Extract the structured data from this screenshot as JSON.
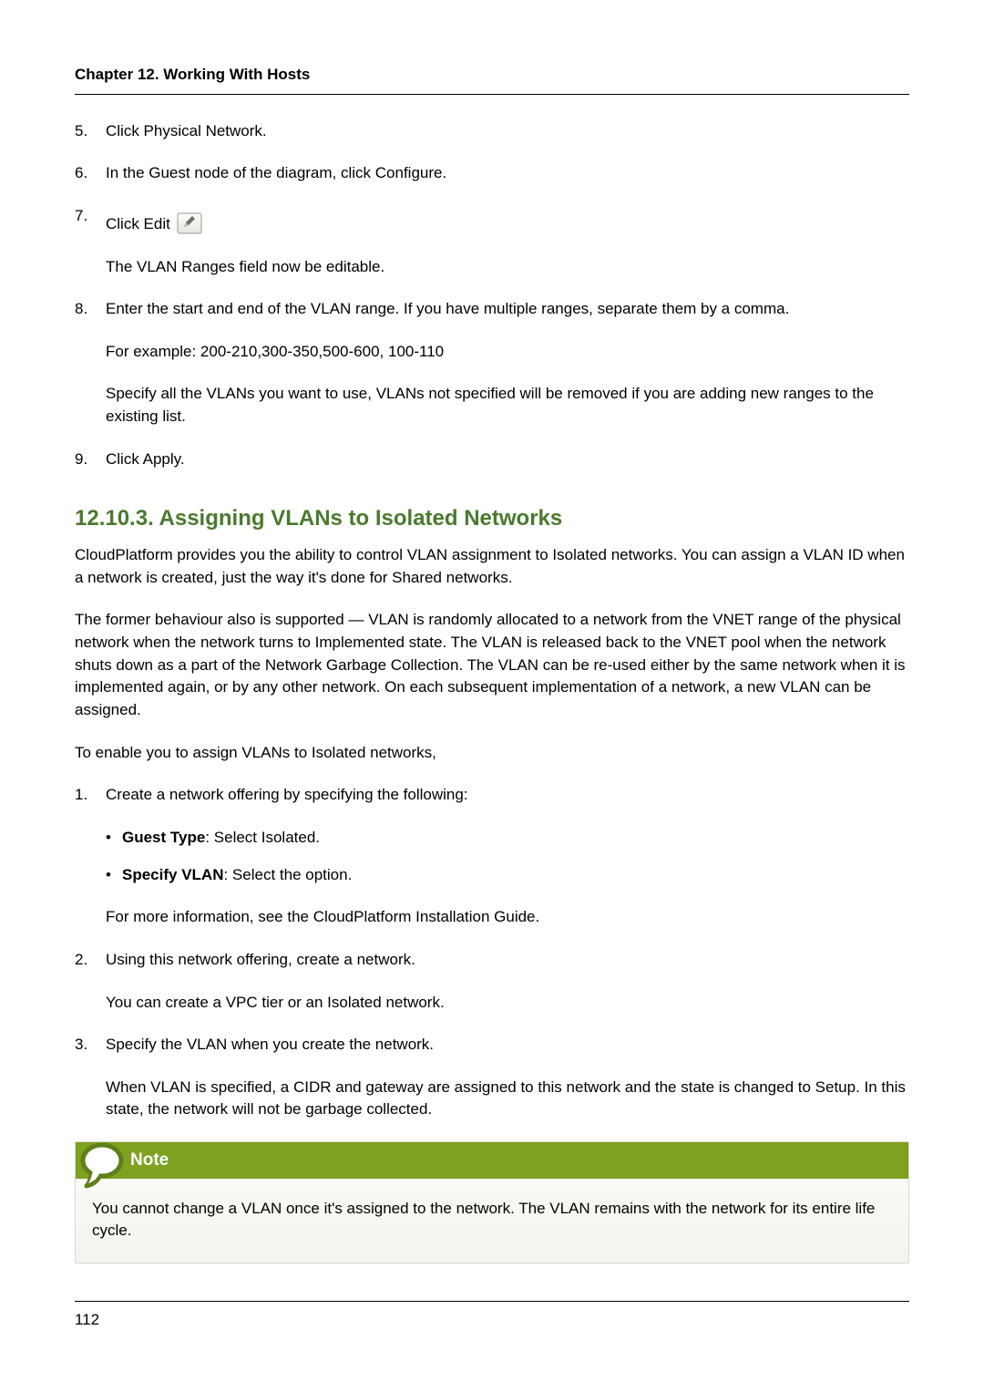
{
  "running_head": "Chapter 12. Working With Hosts",
  "steps_a": {
    "5": {
      "num": "5.",
      "p1": "Click Physical Network."
    },
    "6": {
      "num": "6.",
      "p1": "In the Guest node of the diagram, click Configure."
    },
    "7": {
      "num": "7.",
      "p1_prefix": "Click Edit ",
      "p2": "The VLAN Ranges field now be editable."
    },
    "8": {
      "num": "8.",
      "p1": "Enter the start and end of the VLAN range. If you have multiple ranges, separate them by a comma.",
      "p2": "For example: 200-210,300-350,500-600, 100-110",
      "p3": "Specify all the VLANs you want to use, VLANs not specified will be removed if you are adding new ranges to the existing list."
    },
    "9": {
      "num": "9.",
      "p1": "Click Apply."
    }
  },
  "section": {
    "heading": "12.10.3. Assigning VLANs to Isolated Networks",
    "p1": "CloudPlatform provides you the ability to control VLAN assignment to Isolated networks. You can assign a VLAN ID when a network is created, just the way it's done for Shared networks.",
    "p2": "The former behaviour also is supported — VLAN is randomly allocated to a network from the VNET range of the physical network when the network turns to Implemented state. The VLAN is released back to the VNET pool when the network shuts down as a part of the Network Garbage Collection. The VLAN can be re-used either by the same network when it is implemented again, or by any other network. On each subsequent implementation of a network, a new VLAN can be assigned.",
    "p3": "To enable you to assign VLANs to Isolated networks,"
  },
  "steps_b": {
    "1": {
      "num": "1.",
      "p1": "Create a network offering by specifying the following:",
      "bullets": [
        {
          "label": "Guest Type",
          "rest": ": Select Isolated."
        },
        {
          "label": "Specify VLAN",
          "rest": ": Select the option."
        }
      ],
      "p2": "For more information, see the CloudPlatform Installation Guide."
    },
    "2": {
      "num": "2.",
      "p1": "Using this network offering, create a network.",
      "p2": "You can create a VPC tier or an Isolated network."
    },
    "3": {
      "num": "3.",
      "p1": "Specify the VLAN when you create the network.",
      "p2": "When VLAN is specified, a CIDR and gateway are assigned to this network and the state is changed to Setup. In this state, the network will not be garbage collected."
    }
  },
  "note": {
    "title": "Note",
    "body": "You cannot change a VLAN once it's assigned to the network. The VLAN remains with the network for its entire life cycle."
  },
  "footer_page": "112"
}
